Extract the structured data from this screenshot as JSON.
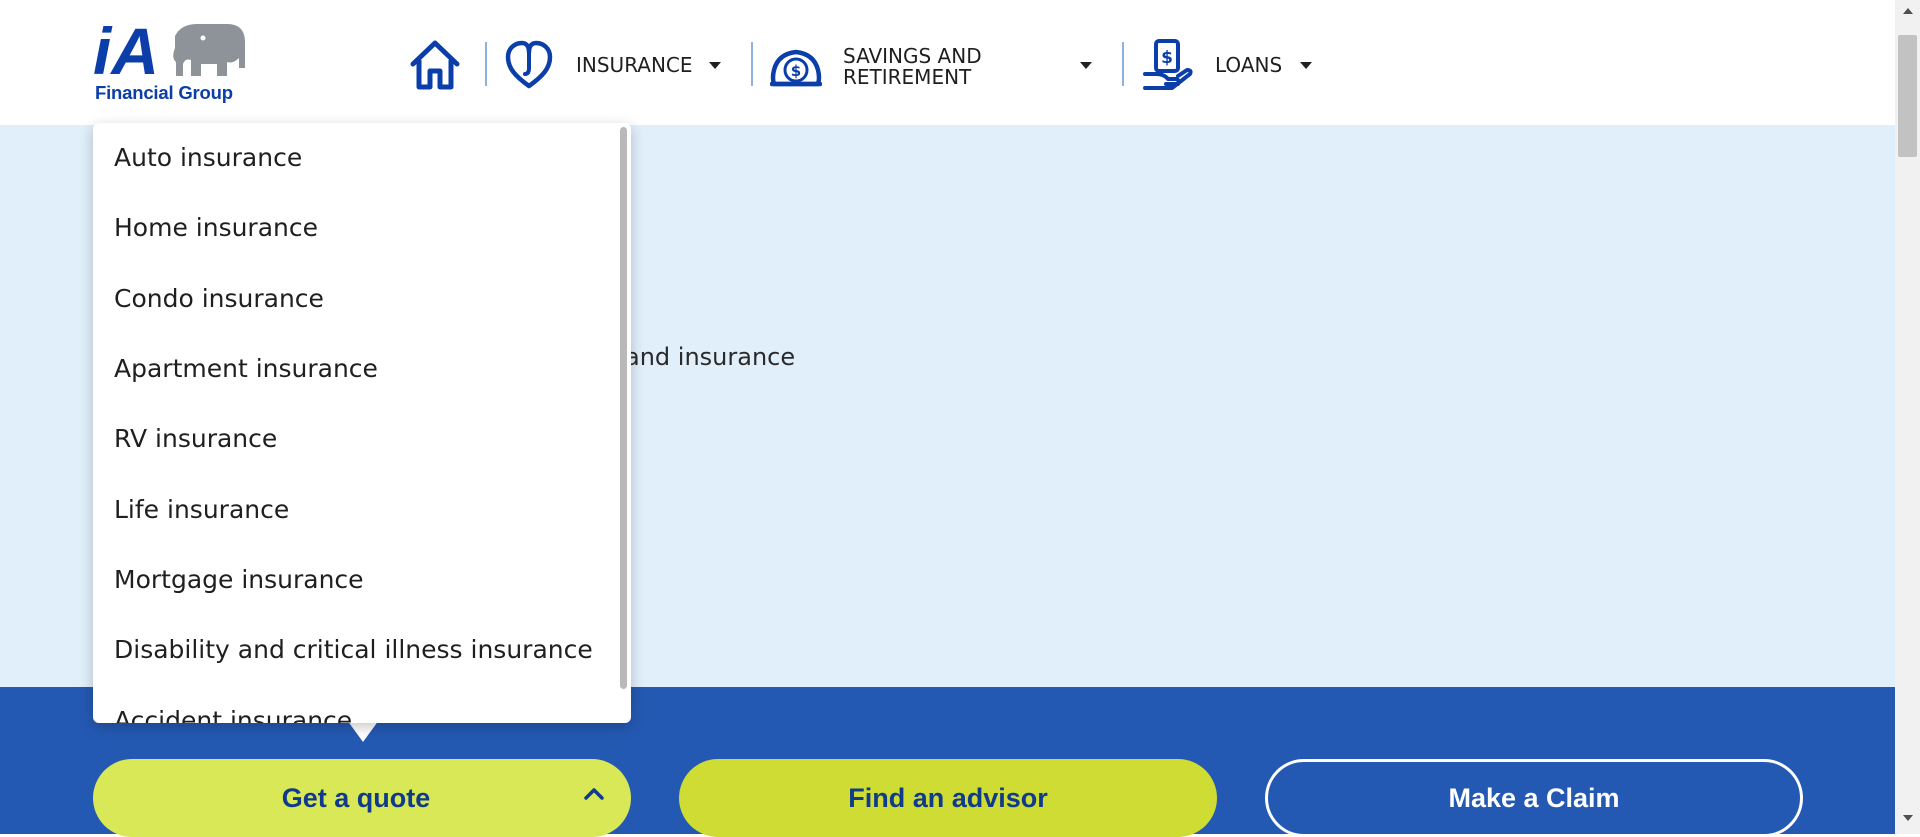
{
  "brand": {
    "logo_text": "iA",
    "tagline": "Financial Group",
    "logo_icon": "elephant-logo-icon",
    "color_primary": "#0b3ea8",
    "color_elephant": "#8d9399"
  },
  "nav": {
    "home_icon": "home-icon",
    "items": [
      {
        "label": "INSURANCE",
        "icon": "heart-icon"
      },
      {
        "label": "SAVINGS AND RETIREMENT",
        "label_line1": "SAVINGS AND",
        "label_line2": "RETIREMENT",
        "icon": "piggy-bank-dollar-icon"
      },
      {
        "label": "LOANS",
        "icon": "hand-dollar-icon"
      }
    ]
  },
  "hero": {
    "partial_text": "and insurance",
    "background": "#e1effb"
  },
  "dropdown": {
    "items": [
      "Auto insurance",
      "Home insurance",
      "Condo insurance",
      "Apartment insurance",
      "RV insurance",
      "Life insurance",
      "Mortgage insurance",
      "Disability and critical illness insurance",
      "Accident insurance"
    ]
  },
  "actions": {
    "background": "#2459b3",
    "get_quote": "Get a quote",
    "find_advisor": "Find an advisor",
    "make_claim": "Make a Claim",
    "quote_color": "#d9e856",
    "advisor_color": "#cedc34"
  }
}
